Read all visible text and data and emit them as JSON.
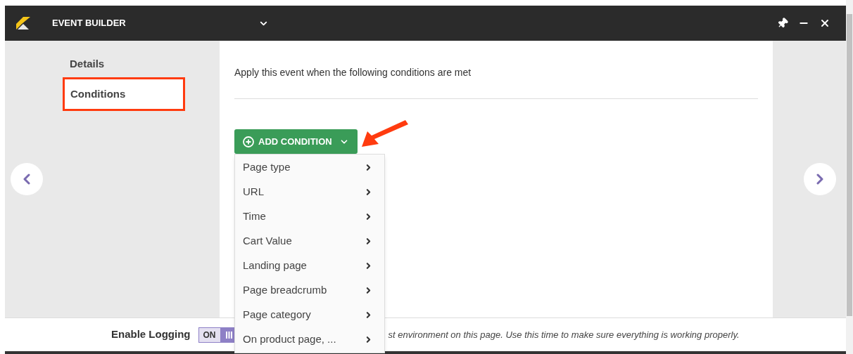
{
  "window": {
    "title": "EVENT BUILDER"
  },
  "sidebar": {
    "items": [
      {
        "label": "Details",
        "selected": false
      },
      {
        "label": "Conditions",
        "selected": true
      }
    ]
  },
  "content": {
    "heading": "Apply this event when the following conditions are met",
    "add_button": {
      "label": "ADD CONDITION"
    },
    "menu": [
      {
        "label": "Page type"
      },
      {
        "label": "URL"
      },
      {
        "label": "Time"
      },
      {
        "label": "Cart Value"
      },
      {
        "label": "Landing page"
      },
      {
        "label": "Page breadcrumb"
      },
      {
        "label": "Page category"
      },
      {
        "label": "On product page, ..."
      }
    ]
  },
  "footer": {
    "logging_label": "Enable Logging",
    "toggle": {
      "label": "ON",
      "on": true
    },
    "message": "st environment on this page. Use this time to make sure everything is working properly."
  }
}
